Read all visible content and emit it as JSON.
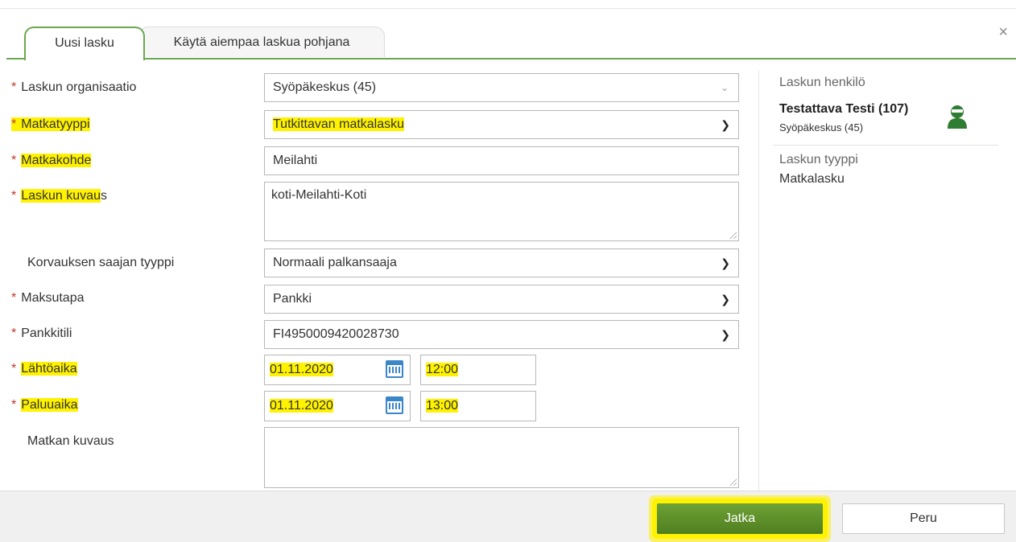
{
  "dialog": {
    "close_glyph": "×",
    "tabs": [
      {
        "label": "Uusi lasku",
        "active": true
      },
      {
        "label": "Käytä aiempaa laskua pohjana",
        "active": false
      }
    ]
  },
  "form": {
    "required_mark": "*",
    "organisaatio": {
      "label": "Laskun organisaatio",
      "value": "Syöpäkeskus (45)"
    },
    "matkatyyppi": {
      "label": "Matkatyyppi",
      "value": "Tutkittavan matkalasku"
    },
    "matkakohde": {
      "label": "Matkakohde",
      "value": "Meilahti"
    },
    "kuvaus": {
      "label_part1": "Laskun kuvau",
      "label_part2": "s",
      "value": "koti-Meilahti-Koti"
    },
    "saajan_tyyppi": {
      "label": "Korvauksen saajan tyyppi",
      "value": "Normaali palkansaaja"
    },
    "maksutapa": {
      "label": "Maksutapa",
      "value": "Pankki"
    },
    "pankkitili": {
      "label": "Pankkitili",
      "value": "FI4950009420028730"
    },
    "lahtoaika": {
      "label": "Lähtöaika",
      "date": "01.11.2020",
      "time": "12:00"
    },
    "paluuaika": {
      "label": "Paluuaika",
      "date": "01.11.2020",
      "time": "13:00"
    },
    "matkan_kuvaus": {
      "label": "Matkan kuvaus",
      "value": ""
    }
  },
  "side_panel": {
    "henkilo_caption": "Laskun henkilö",
    "henkilo_name": "Testattava Testi (107)",
    "henkilo_org": "Syöpäkeskus (45)",
    "tyyppi_caption": "Laskun tyyppi",
    "tyyppi_value": "Matkalasku"
  },
  "footer": {
    "continue_label": "Jatka",
    "cancel_label": "Peru"
  },
  "colors": {
    "accent_green": "#6aa84f",
    "highlight_yellow": "#fff200",
    "required_red": "#c0392b",
    "calendar_blue": "#3b86c8"
  }
}
